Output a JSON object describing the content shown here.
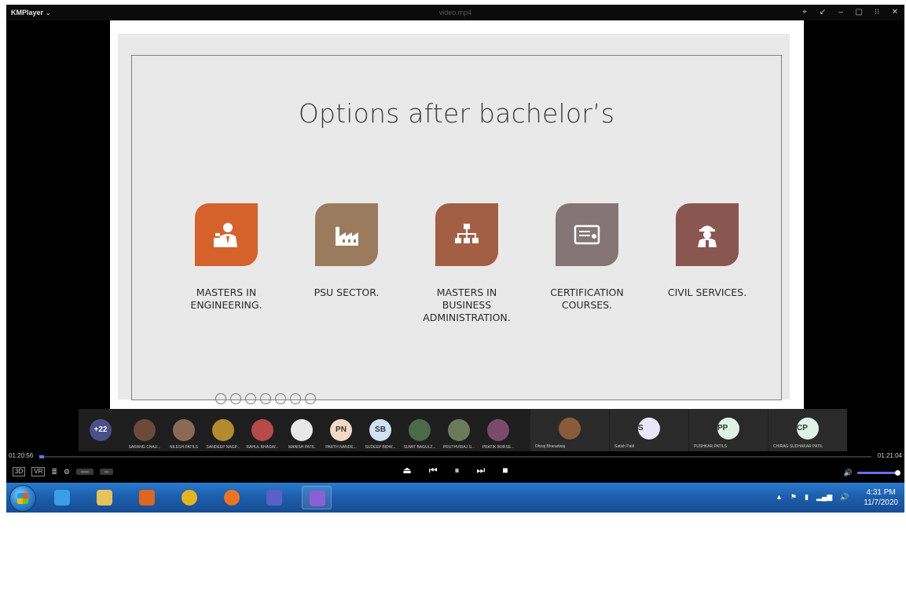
{
  "app": {
    "brand": "KMPlayer",
    "file_title": "video.mp4"
  },
  "slide": {
    "title": "Options after bachelor’s",
    "options": [
      {
        "label": "MASTERS IN\nENGINEERING.",
        "color": "#d4622a",
        "icon": "engineer-icon"
      },
      {
        "label": "PSU SECTOR.",
        "color": "#9a7b5e",
        "icon": "factory-icon"
      },
      {
        "label": "MASTERS IN\nBUSINESS\nADMINISTRATION.",
        "color": "#a35f44",
        "icon": "org-chart-icon"
      },
      {
        "label": "CERTIFICATION\nCOURSES.",
        "color": "#857577",
        "icon": "certificate-icon"
      },
      {
        "label": "CIVIL SERVICES.",
        "color": "#8a5750",
        "icon": "officer-icon"
      }
    ]
  },
  "participants": {
    "more_count": "+22",
    "strip": [
      {
        "name": "SARANG CHAU...",
        "color": "#6b4a3a"
      },
      {
        "name": "NILESH.PATILS",
        "color": "#8a6a55"
      },
      {
        "name": "SANDEEP NAGP...",
        "color": "#b38a2e"
      },
      {
        "name": "RAHUL BHAGW...",
        "color": "#b54a4a"
      },
      {
        "name": "MANISH PATIL",
        "color": "#e8e8e8"
      },
      {
        "name": "PARTH NANDE...",
        "initials": "PN",
        "color": "#f3d9c7"
      },
      {
        "name": "SUDEEP BIDW...",
        "initials": "SB",
        "color": "#cfe2f6"
      },
      {
        "name": "SUMIT BAGUL2...",
        "color": "#4a6a4a"
      },
      {
        "name": "PRUTHVIRAJ S...",
        "color": "#6a7a5a"
      },
      {
        "name": "PRATIK BORSE...",
        "color": "#7a4a6a"
      }
    ],
    "tiles": [
      {
        "name": "Dhiraj Bharadwaj",
        "color": "#8a5a3a"
      },
      {
        "name": "Satish Patil",
        "initials": "S",
        "color": "#e8e6f8"
      },
      {
        "name": "PUSHKAR.PATILS",
        "initials": "PP",
        "color": "#dff2e6"
      },
      {
        "name": "CHIRAG SUDHAKAR PATIL",
        "initials": "CP",
        "color": "#dff2e6"
      }
    ]
  },
  "playback": {
    "elapsed": "01:20:56",
    "total": "01:21:04",
    "progress": 0.005,
    "left_buttons": [
      "3D",
      "VR"
    ]
  },
  "taskbar": {
    "time": "4:31 PM",
    "date": "11/7/2020",
    "apps": [
      {
        "name": "internet-explorer-icon",
        "color": "#3a9ee8"
      },
      {
        "name": "file-explorer-icon",
        "color": "#e7c35a"
      },
      {
        "name": "media-player-icon",
        "color": "#e0651f"
      },
      {
        "name": "chrome-icon",
        "color": "#e6b41c"
      },
      {
        "name": "firefox-icon",
        "color": "#f0731f"
      },
      {
        "name": "teams-icon",
        "color": "#5b5fc7"
      },
      {
        "name": "kmplayer-icon",
        "color": "#8b5fd6"
      }
    ]
  }
}
